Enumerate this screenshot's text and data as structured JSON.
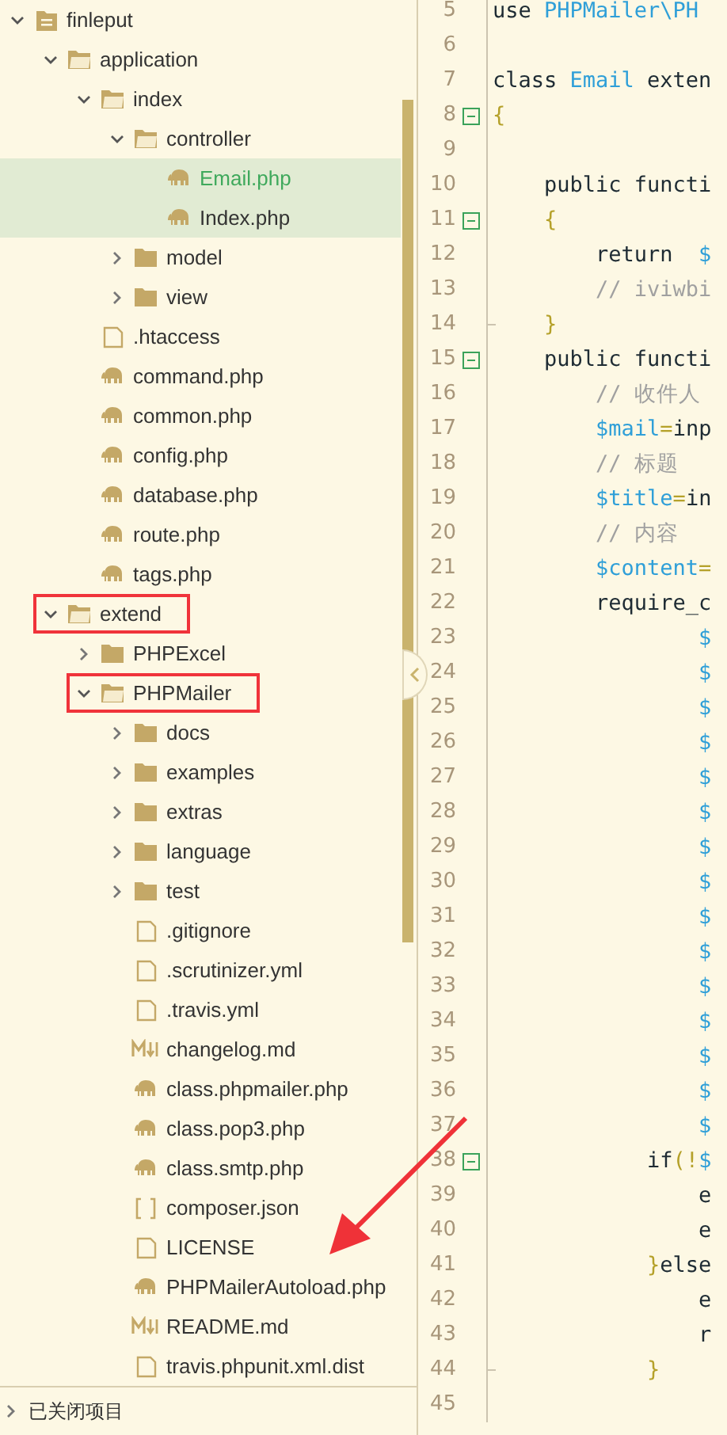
{
  "tree": [
    {
      "label": "finleput",
      "kind": "project",
      "expanded": true,
      "children": [
        {
          "label": "application",
          "kind": "folder",
          "expanded": true,
          "children": [
            {
              "label": "index",
              "kind": "folder",
              "expanded": true,
              "children": [
                {
                  "label": "controller",
                  "kind": "folder",
                  "expanded": true,
                  "children": [
                    {
                      "label": "Email.php",
                      "kind": "php",
                      "selected": true,
                      "active": true
                    },
                    {
                      "label": "Index.php",
                      "kind": "php",
                      "selected": true,
                      "active": false
                    }
                  ]
                },
                {
                  "label": "model",
                  "kind": "folder",
                  "expanded": false
                },
                {
                  "label": "view",
                  "kind": "folder",
                  "expanded": false
                }
              ]
            },
            {
              "label": ".htaccess",
              "kind": "file"
            },
            {
              "label": "command.php",
              "kind": "php"
            },
            {
              "label": "common.php",
              "kind": "php"
            },
            {
              "label": "config.php",
              "kind": "php"
            },
            {
              "label": "database.php",
              "kind": "php"
            },
            {
              "label": "route.php",
              "kind": "php"
            },
            {
              "label": "tags.php",
              "kind": "php"
            }
          ]
        },
        {
          "label": "extend",
          "kind": "folder",
          "expanded": true,
          "annotated": true,
          "children": [
            {
              "label": "PHPExcel",
              "kind": "folder",
              "expanded": false
            },
            {
              "label": "PHPMailer",
              "kind": "folder",
              "expanded": true,
              "annotated": true,
              "children": [
                {
                  "label": "docs",
                  "kind": "folder",
                  "expanded": false
                },
                {
                  "label": "examples",
                  "kind": "folder",
                  "expanded": false
                },
                {
                  "label": "extras",
                  "kind": "folder",
                  "expanded": false
                },
                {
                  "label": "language",
                  "kind": "folder",
                  "expanded": false
                },
                {
                  "label": "test",
                  "kind": "folder",
                  "expanded": false
                },
                {
                  "label": ".gitignore",
                  "kind": "file"
                },
                {
                  "label": ".scrutinizer.yml",
                  "kind": "file"
                },
                {
                  "label": ".travis.yml",
                  "kind": "file"
                },
                {
                  "label": "changelog.md",
                  "kind": "markdown"
                },
                {
                  "label": "class.phpmailer.php",
                  "kind": "php"
                },
                {
                  "label": "class.pop3.php",
                  "kind": "php"
                },
                {
                  "label": "class.smtp.php",
                  "kind": "php"
                },
                {
                  "label": "composer.json",
                  "kind": "json"
                },
                {
                  "label": "LICENSE",
                  "kind": "file"
                },
                {
                  "label": "PHPMailerAutoload.php",
                  "kind": "php"
                },
                {
                  "label": "README.md",
                  "kind": "markdown"
                },
                {
                  "label": "travis.phpunit.xml.dist",
                  "kind": "file"
                }
              ]
            }
          ]
        }
      ]
    }
  ],
  "closed_projects": {
    "label": "已关闭项目",
    "expanded": false
  },
  "editor": {
    "lines": [
      {
        "number": "5",
        "segments": [
          {
            "text": "use ",
            "kind": "plain"
          },
          {
            "text": "PHPMailer\\PH",
            "kind": "type"
          }
        ]
      },
      {
        "number": "6"
      },
      {
        "number": "7",
        "segments": [
          {
            "text": "class ",
            "kind": "plain"
          },
          {
            "text": "Email",
            "kind": "type"
          },
          {
            "text": " exten",
            "kind": "plain"
          }
        ]
      },
      {
        "number": "8",
        "fold_toggle": true,
        "segments": [
          {
            "text": "{",
            "kind": "brace"
          }
        ]
      },
      {
        "number": "9"
      },
      {
        "number": "10",
        "segments": [
          {
            "text": "    public functi",
            "kind": "plain"
          }
        ]
      },
      {
        "number": "11",
        "fold_toggle": true,
        "segments": [
          {
            "text": "    {",
            "kind": "brace"
          }
        ]
      },
      {
        "number": "12",
        "segments": [
          {
            "text": "        return  ",
            "kind": "plain"
          },
          {
            "text": "$",
            "kind": "variable"
          }
        ]
      },
      {
        "number": "13",
        "segments": [
          {
            "text": "        // iviwbi",
            "kind": "comment"
          }
        ]
      },
      {
        "number": "14",
        "fold_end": true,
        "segments": [
          {
            "text": "    }",
            "kind": "brace"
          }
        ]
      },
      {
        "number": "15",
        "fold_toggle": true,
        "segments": [
          {
            "text": "    public functi",
            "kind": "plain"
          }
        ]
      },
      {
        "number": "16",
        "segments": [
          {
            "text": "        // 收件人",
            "kind": "comment"
          }
        ]
      },
      {
        "number": "17",
        "segments": [
          {
            "text": "        $mail",
            "kind": "variable"
          },
          {
            "text": "=",
            "kind": "brace"
          },
          {
            "text": "inp",
            "kind": "plain"
          }
        ]
      },
      {
        "number": "18",
        "segments": [
          {
            "text": "        // 标题",
            "kind": "comment"
          }
        ]
      },
      {
        "number": "19",
        "segments": [
          {
            "text": "        $title",
            "kind": "variable"
          },
          {
            "text": "=",
            "kind": "brace"
          },
          {
            "text": "in",
            "kind": "plain"
          }
        ]
      },
      {
        "number": "20",
        "segments": [
          {
            "text": "        // 内容",
            "kind": "comment"
          }
        ]
      },
      {
        "number": "21",
        "segments": [
          {
            "text": "        $content",
            "kind": "variable"
          },
          {
            "text": "=",
            "kind": "brace"
          }
        ]
      },
      {
        "number": "22",
        "segments": [
          {
            "text": "        require_c",
            "kind": "plain"
          }
        ]
      },
      {
        "number": "23",
        "segments": [
          {
            "text": "                $",
            "kind": "variable"
          }
        ]
      },
      {
        "number": "24",
        "segments": [
          {
            "text": "                $",
            "kind": "variable"
          }
        ]
      },
      {
        "number": "25",
        "segments": [
          {
            "text": "                $",
            "kind": "variable"
          }
        ]
      },
      {
        "number": "26",
        "segments": [
          {
            "text": "                $",
            "kind": "variable"
          }
        ]
      },
      {
        "number": "27",
        "segments": [
          {
            "text": "                $",
            "kind": "variable"
          }
        ]
      },
      {
        "number": "28",
        "segments": [
          {
            "text": "                $",
            "kind": "variable"
          }
        ]
      },
      {
        "number": "29",
        "segments": [
          {
            "text": "                $",
            "kind": "variable"
          }
        ]
      },
      {
        "number": "30",
        "segments": [
          {
            "text": "                $",
            "kind": "variable"
          }
        ]
      },
      {
        "number": "31",
        "segments": [
          {
            "text": "                $",
            "kind": "variable"
          }
        ]
      },
      {
        "number": "32",
        "segments": [
          {
            "text": "                $",
            "kind": "variable"
          }
        ]
      },
      {
        "number": "33",
        "segments": [
          {
            "text": "                $",
            "kind": "variable"
          }
        ]
      },
      {
        "number": "34",
        "segments": [
          {
            "text": "                $",
            "kind": "variable"
          }
        ]
      },
      {
        "number": "35",
        "segments": [
          {
            "text": "                $",
            "kind": "variable"
          }
        ]
      },
      {
        "number": "36",
        "segments": [
          {
            "text": "                $",
            "kind": "variable"
          }
        ]
      },
      {
        "number": "37",
        "segments": [
          {
            "text": "                $",
            "kind": "variable"
          }
        ]
      },
      {
        "number": "38",
        "fold_toggle": true,
        "segments": [
          {
            "text": "            if",
            "kind": "plain"
          },
          {
            "text": "(!",
            "kind": "brace"
          },
          {
            "text": "$",
            "kind": "variable"
          }
        ]
      },
      {
        "number": "39",
        "segments": [
          {
            "text": "                e",
            "kind": "plain"
          }
        ]
      },
      {
        "number": "40",
        "segments": [
          {
            "text": "                e",
            "kind": "plain"
          }
        ]
      },
      {
        "number": "41",
        "segments": [
          {
            "text": "            }",
            "kind": "brace"
          },
          {
            "text": "else",
            "kind": "plain"
          }
        ]
      },
      {
        "number": "42",
        "segments": [
          {
            "text": "                e",
            "kind": "plain"
          }
        ]
      },
      {
        "number": "43",
        "segments": [
          {
            "text": "                r",
            "kind": "plain"
          }
        ]
      },
      {
        "number": "44",
        "fold_end": true,
        "segments": [
          {
            "text": "            }",
            "kind": "brace"
          }
        ]
      },
      {
        "number": "45"
      }
    ]
  }
}
